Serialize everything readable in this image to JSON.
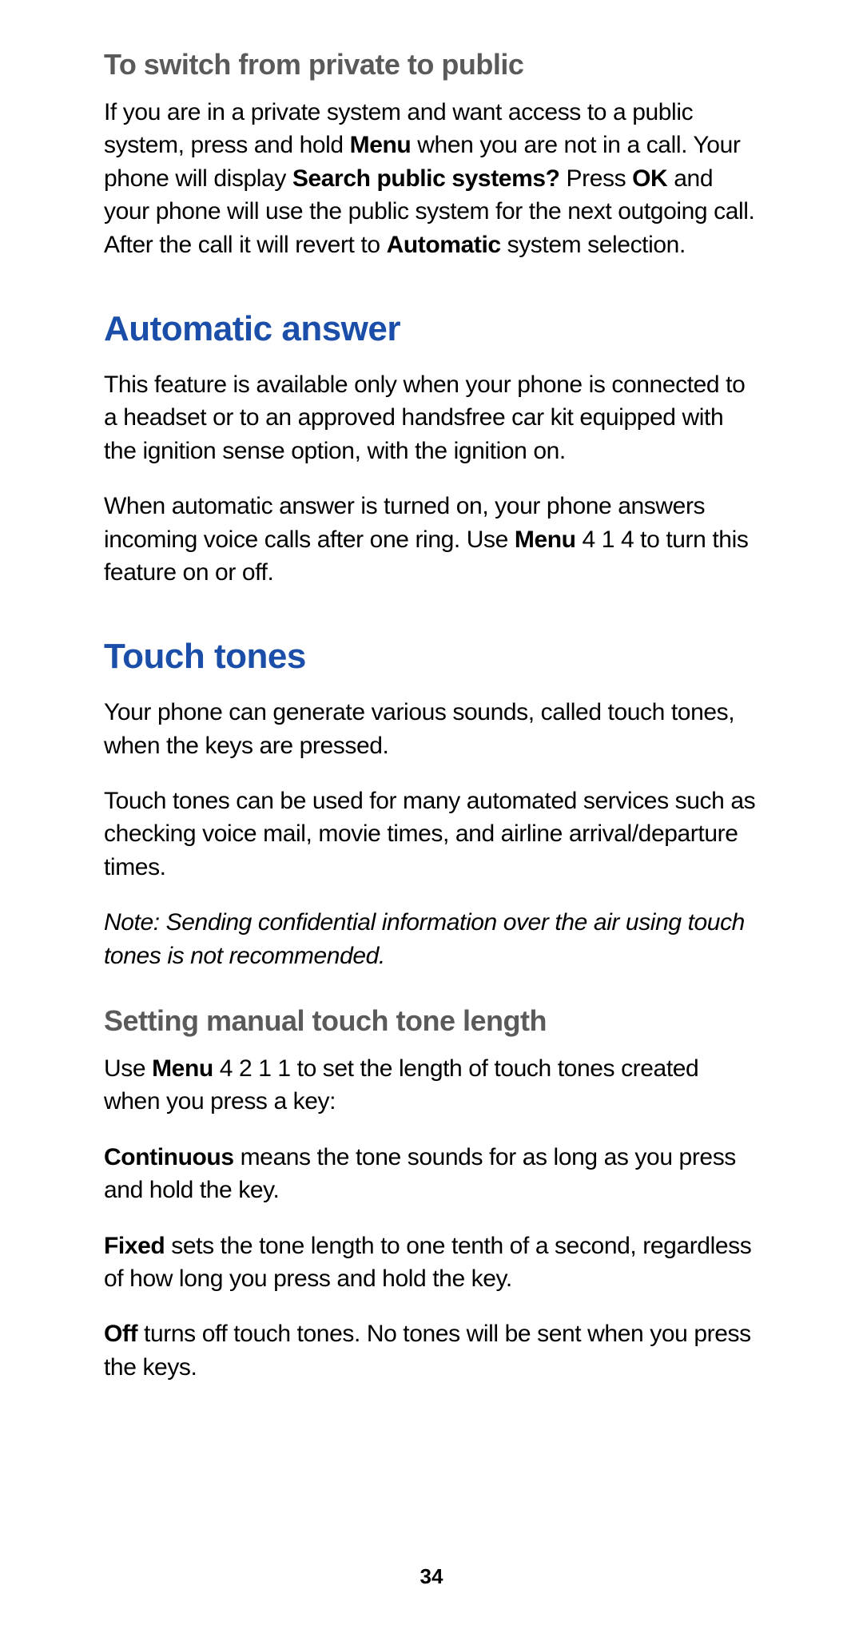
{
  "subheading1": "To switch from private to public",
  "p1_a": "If you are in a private system and want access to a public system, press and hold ",
  "p1_b": "Menu",
  "p1_c": " when you are not in a call. Your phone will display ",
  "p1_d": "Search public systems?",
  "p1_e": " Press ",
  "p1_f": "OK",
  "p1_g": " and your phone will use the public system for the next outgoing call. After the call it will revert to ",
  "p1_h": "Automatic",
  "p1_i": " system selection.",
  "heading1": "Automatic answer",
  "p2": "This feature is available only when your phone is connected to a headset or to an approved handsfree car kit equipped with the ignition sense option, with the ignition on.",
  "p3_a": "When automatic answer is turned on, your phone answers incoming voice calls after one ring. Use ",
  "p3_b": "Menu",
  "p3_c": " 4 1 4 to turn this feature on or off.",
  "heading2": "Touch tones",
  "p4": "Your phone can generate various sounds, called touch tones, when the keys are pressed.",
  "p5": "Touch tones can be used for many automated services such as checking voice mail, movie times, and airline arrival/departure times.",
  "note": "Note:  Sending confidential information over the air using touch tones is not recommended.",
  "subheading2": "Setting manual touch tone length",
  "p6_a": "Use ",
  "p6_b": "Menu",
  "p6_c": " 4 2 1 1 to set the length of touch tones created when you press a key:",
  "p7_a": "Continuous",
  "p7_b": " means the tone sounds for as long as you press and hold the key.",
  "p8_a": "Fixed",
  "p8_b": " sets the tone length to one tenth of a second, regardless of how long you press and hold the key.",
  "p9_a": "Off",
  "p9_b": " turns off touch tones. No tones will be sent when you press the keys.",
  "page_number": "34"
}
